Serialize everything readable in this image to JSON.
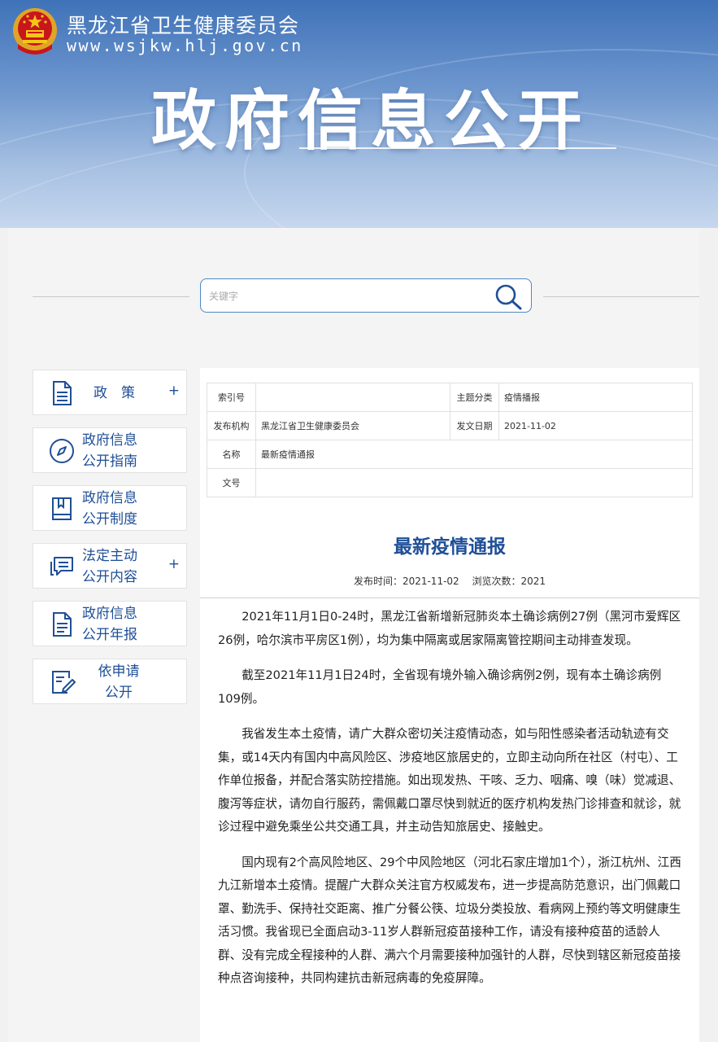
{
  "header": {
    "site_name": "黑龙江省卫生健康委员会",
    "site_url": "www.wsjkw.hlj.gov.cn",
    "banner_title": "政府信息公开",
    "colors": {
      "banner_top": "#3f72b8",
      "banner_bottom": "#c6d7ee",
      "accent": "#1f4f97"
    }
  },
  "search": {
    "placeholder": "关键字",
    "icon": "search-icon"
  },
  "sidebar": {
    "items": [
      {
        "line1": "政　策",
        "line2": "",
        "plus": "+",
        "icon": "document-icon"
      },
      {
        "line1": "政府信息",
        "line2": "公开指南",
        "plus": "",
        "icon": "compass-icon"
      },
      {
        "line1": "政府信息",
        "line2": "公开制度",
        "plus": "",
        "icon": "book-icon"
      },
      {
        "line1": "法定主动",
        "line2": "公开内容",
        "plus": "+",
        "icon": "chat-icon"
      },
      {
        "line1": "政府信息",
        "line2": "公开年报",
        "plus": "",
        "icon": "report-icon"
      },
      {
        "line1": "依申请",
        "line2": "公开",
        "plus": "",
        "icon": "edit-form-icon"
      }
    ]
  },
  "meta": {
    "index_label": "索引号",
    "index_value": "",
    "topic_label": "主题分类",
    "topic_value": "疫情播报",
    "org_label": "发布机构",
    "org_value": "黑龙江省卫生健康委员会",
    "date_label": "发文日期",
    "date_value": "2021-11-02",
    "name_label": "名称",
    "name_value": "最新疫情通报",
    "doc_label": "文号",
    "doc_value": ""
  },
  "article": {
    "title": "最新疫情通报",
    "publish_time": "发布时间：2021-11-02",
    "views": "浏览次数：2021",
    "paragraphs": [
      "2021年11月1日0-24时，黑龙江省新增新冠肺炎本土确诊病例27例（黑河市爱辉区26例，哈尔滨市平房区1例），均为集中隔离或居家隔离管控期间主动排查发现。",
      "截至2021年11月1日24时，全省现有境外输入确诊病例2例，现有本土确诊病例109例。",
      "我省发生本土疫情，请广大群众密切关注疫情动态，如与阳性感染者活动轨迹有交集，或14天内有国内中高风险区、涉疫地区旅居史的，立即主动向所在社区（村屯）、工作单位报备，并配合落实防控措施。如出现发热、干咳、乏力、咽痛、嗅（味）觉减退、腹泻等症状，请勿自行服药，需佩戴口罩尽快到就近的医疗机构发热门诊排查和就诊，就诊过程中避免乘坐公共交通工具，并主动告知旅居史、接触史。",
      "国内现有2个高风险地区、29个中风险地区（河北石家庄增加1个），浙江杭州、江西九江新增本土疫情。提醒广大群众关注官方权威发布，进一步提高防范意识，出门佩戴口罩、勤洗手、保持社交距离、推广分餐公筷、垃圾分类投放、看病网上预约等文明健康生活习惯。我省现已全面启动3-11岁人群新冠疫苗接种工作，请没有接种疫苗的适龄人群、没有完成全程接种的人群、满六个月需要接种加强针的人群，尽快到辖区新冠疫苗接种点咨询接种，共同构建抗击新冠病毒的免疫屏障。"
    ]
  }
}
